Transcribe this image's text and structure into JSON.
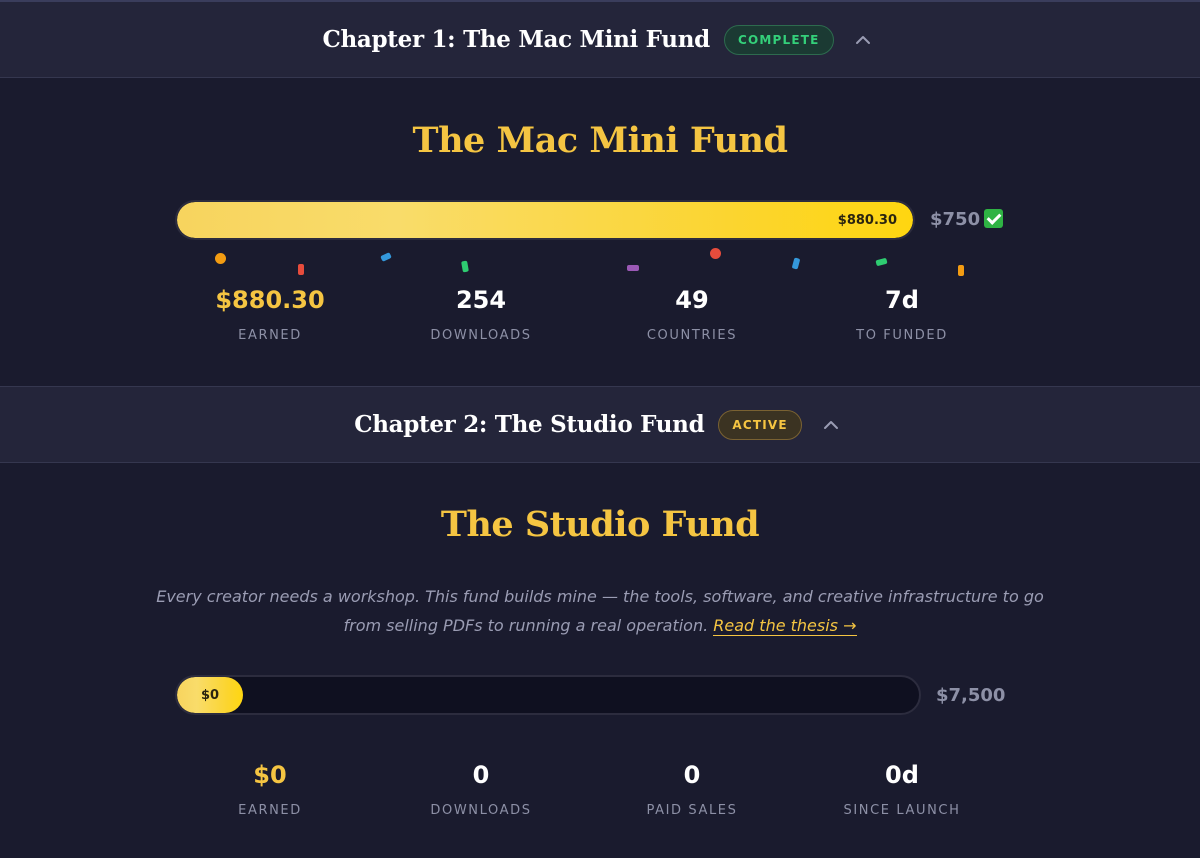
{
  "chapter1": {
    "header_title": "Chapter 1: The Mac Mini Fund",
    "status": "COMPLETE",
    "fund_title": "The Mac Mini Fund",
    "progress_label": "$880.30",
    "progress_fraction": 1.0,
    "goal": "$750",
    "goal_icon": "check-mark-icon",
    "stats": [
      {
        "value": "$880.30",
        "label": "EARNED"
      },
      {
        "value": "254",
        "label": "DOWNLOADS"
      },
      {
        "value": "49",
        "label": "COUNTRIES"
      },
      {
        "value": "7d",
        "label": "TO FUNDED"
      }
    ]
  },
  "chapter2": {
    "header_title": "Chapter 2: The Studio Fund",
    "status": "ACTIVE",
    "fund_title": "The Studio Fund",
    "description": "Every creator needs a workshop. This fund builds mine — the tools, software, and creative infrastructure to go from selling PDFs to running a real operation.",
    "link_text": "Read the thesis →",
    "progress_label": "$0",
    "progress_fraction": 0.0,
    "goal": "$7,500",
    "stats": [
      {
        "value": "$0",
        "label": "EARNED"
      },
      {
        "value": "0",
        "label": "DOWNLOADS"
      },
      {
        "value": "0",
        "label": "PAID SALES"
      },
      {
        "value": "0d",
        "label": "SINCE LAUNCH"
      }
    ]
  },
  "colors": {
    "background": "#1a1b2e",
    "header_background": "#24253a",
    "accent_gold": "#f5c542",
    "complete_green": "#34d07a",
    "muted_text": "#8d90a6"
  }
}
